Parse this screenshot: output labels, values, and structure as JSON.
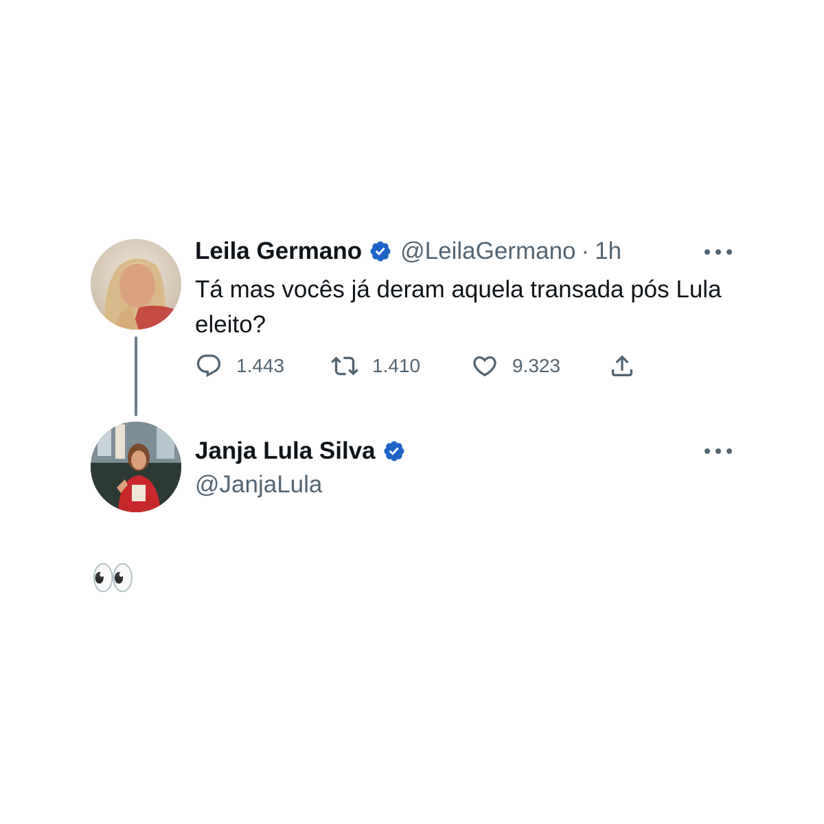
{
  "tweet": {
    "author_name": "Leila Germano",
    "author_handle": "@LeilaGermano",
    "separator": "·",
    "time": "1h",
    "text": "Tá mas vocês já deram aquela transada pós Lula eleito?",
    "reply_count": "1.443",
    "retweet_count": "1.410",
    "like_count": "9.323"
  },
  "reply": {
    "author_name": "Janja Lula Silva",
    "author_handle": "@JanjaLula",
    "text": "👀"
  },
  "colors": {
    "verified_badge": "#1d63c6",
    "secondary_text": "#536471",
    "primary_text": "#0f1419",
    "thread_line": "#6e7b86"
  }
}
